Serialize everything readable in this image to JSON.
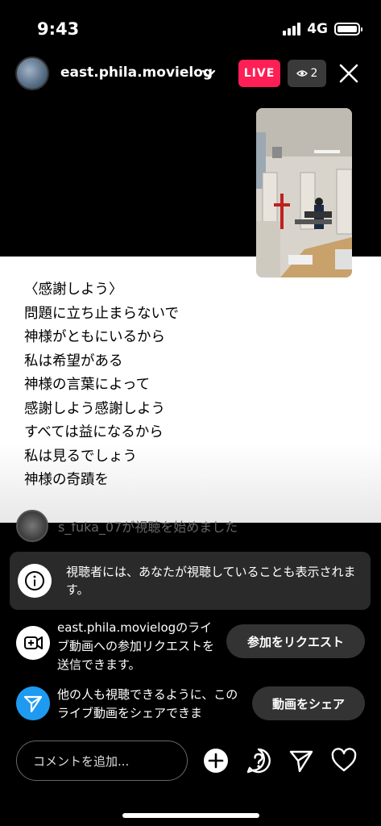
{
  "status_bar": {
    "time": "9:43",
    "network": "4G"
  },
  "header": {
    "username": "east.phila.movielog",
    "live_label": "LIVE",
    "viewer_count": "2"
  },
  "lyrics": [
    "〈感謝しよう〉",
    "問題に立ち止まらないで",
    "神様がともにいるから",
    "私は希望がある",
    "神様の言葉によって",
    "感謝しよう感謝しよう",
    "すべては益になるから",
    "私は見るでしょう",
    "神様の奇蹟を"
  ],
  "comment": {
    "text": "s_fuka_07が視聴を始めました"
  },
  "info_card": {
    "text": "視聴者には、あなたが視聴していることも表示されます。"
  },
  "join_request": {
    "text": "east.phila.movielogのライブ動画への参加リクエストを送信できます。",
    "button": "参加をリクエスト"
  },
  "share": {
    "text": "他の人も視聴できるように、このライブ動画をシェアできま",
    "button": "動画をシェア"
  },
  "comment_input": {
    "placeholder": "コメントを追加..."
  },
  "icons": [
    "chevron-down-icon",
    "eye-icon",
    "close-icon",
    "info-icon",
    "video-add-icon",
    "send-icon",
    "plus-icon",
    "question-icon",
    "paper-plane-icon",
    "heart-icon"
  ],
  "colors": {
    "live": "#ff1f55",
    "share_icon": "#1e9af0"
  }
}
